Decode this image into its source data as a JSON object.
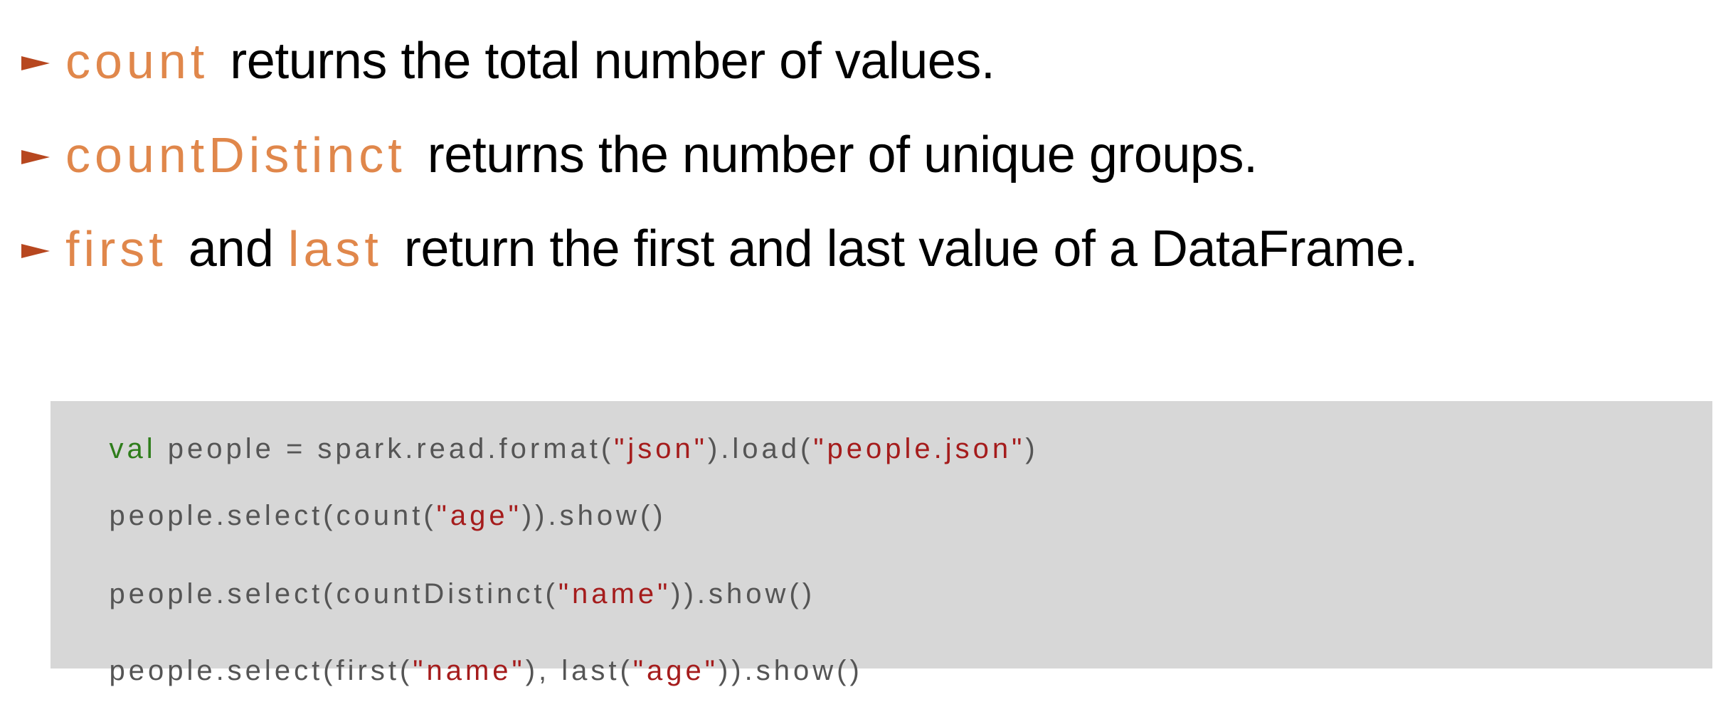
{
  "bullets": [
    {
      "parts": [
        {
          "text": "count",
          "style": "kw"
        },
        {
          "text": "returns the total number of values.",
          "style": "txt"
        }
      ]
    },
    {
      "parts": [
        {
          "text": "countDistinct",
          "style": "kw"
        },
        {
          "text": "returns the number of unique groups.",
          "style": "txt"
        }
      ]
    },
    {
      "parts": [
        {
          "text": "first",
          "style": "kw"
        },
        {
          "text": "and",
          "style": "mid"
        },
        {
          "text": "last",
          "style": "kw"
        },
        {
          "text": "return the first and last value of a DataFrame.",
          "style": "txt"
        }
      ]
    }
  ],
  "code": {
    "background": "#d7d7d7",
    "lines": [
      [
        {
          "text": "val",
          "style": "kw"
        },
        {
          "text": " people = spark.read.format(",
          "style": "plain"
        },
        {
          "text": "\"json\"",
          "style": "str"
        },
        {
          "text": ").load(",
          "style": "plain"
        },
        {
          "text": "\"people.json\"",
          "style": "str"
        },
        {
          "text": ")",
          "style": "plain"
        }
      ],
      [
        {
          "text": "people.select(count(",
          "style": "plain"
        },
        {
          "text": "\"age\"",
          "style": "str"
        },
        {
          "text": ")).show()",
          "style": "plain"
        }
      ],
      [
        {
          "text": "people.select(countDistinct(",
          "style": "plain"
        },
        {
          "text": "\"name\"",
          "style": "str"
        },
        {
          "text": ")).show()",
          "style": "plain"
        }
      ],
      [
        {
          "text": "people.select(first(",
          "style": "plain"
        },
        {
          "text": "\"name\"",
          "style": "str"
        },
        {
          "text": "), last(",
          "style": "plain"
        },
        {
          "text": "\"age\"",
          "style": "str"
        },
        {
          "text": ")).show()",
          "style": "plain"
        }
      ]
    ]
  },
  "colors": {
    "arrow": "#b7471f",
    "keyword": "#e0874b",
    "code_keyword": "#2e7d1b",
    "code_string": "#a51c1c",
    "code_plain": "#555555"
  },
  "icons": {
    "bullet": "right-pointer-icon"
  }
}
